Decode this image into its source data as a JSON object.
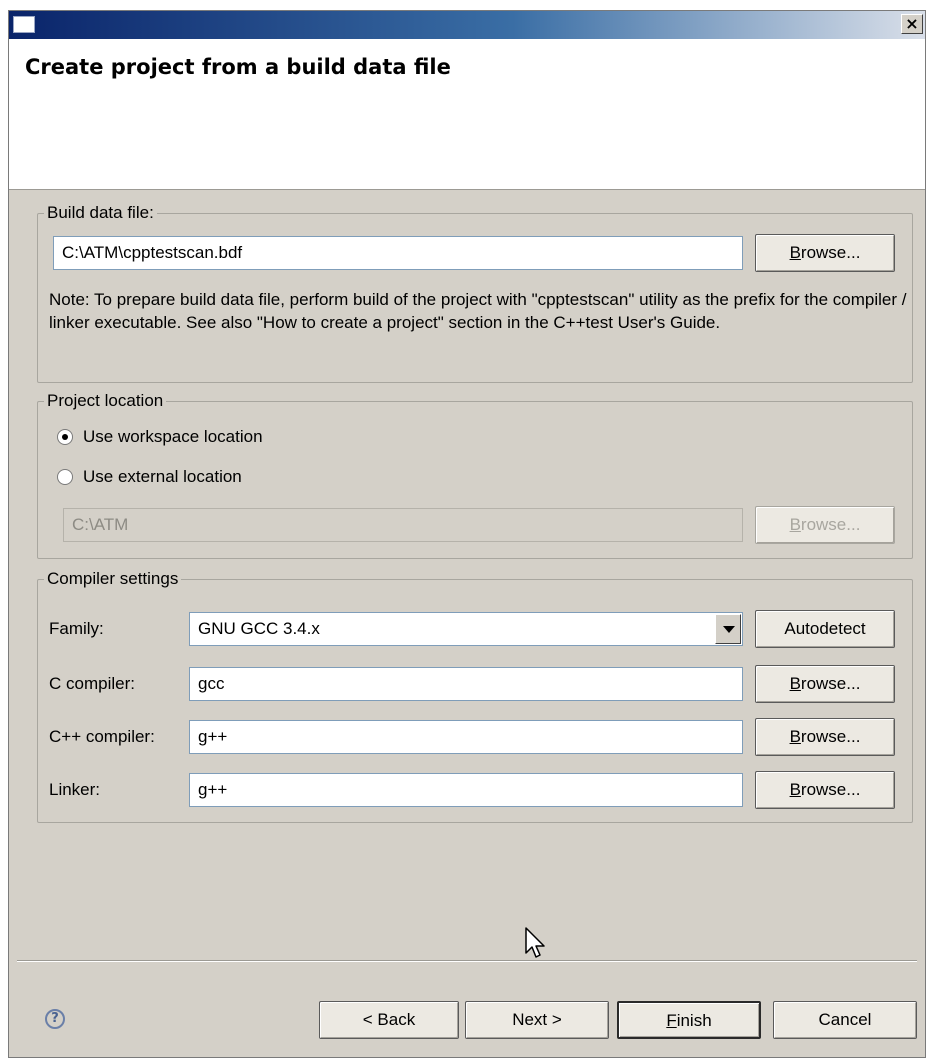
{
  "window": {
    "title_icon": "window-icon",
    "close_label": "×",
    "header_title": "Create project from a build data file"
  },
  "build_data": {
    "legend": "Build data file:",
    "path_value": "C:\\ATM\\cpptestscan.bdf",
    "browse_label": "Browse...",
    "note": "Note: To prepare build data file, perform build of the project with \"cpptestscan\" utility as the prefix for the compiler / linker executable. See also \"How to create a project\" section in the C++test User's Guide."
  },
  "project_location": {
    "legend": "Project location",
    "option_workspace": "Use workspace location",
    "option_external": "Use external location",
    "selected": "workspace",
    "path_value": "C:\\ATM",
    "browse_label": "Browse..."
  },
  "compiler": {
    "legend": "Compiler settings",
    "family_label": "Family:",
    "family_value": "GNU GCC 3.4.x",
    "autodetect_label": "Autodetect",
    "c_compiler_label": "C compiler:",
    "c_compiler_value": "gcc",
    "cpp_compiler_label": "C++ compiler:",
    "cpp_compiler_value": "g++",
    "linker_label": "Linker:",
    "linker_value": "g++",
    "browse_label": "Browse..."
  },
  "footer": {
    "help_icon": "help-icon",
    "help_glyph": "?",
    "back_label": "< Back",
    "next_label": "Next >",
    "finish_label": "Finish",
    "cancel_label": "Cancel"
  }
}
